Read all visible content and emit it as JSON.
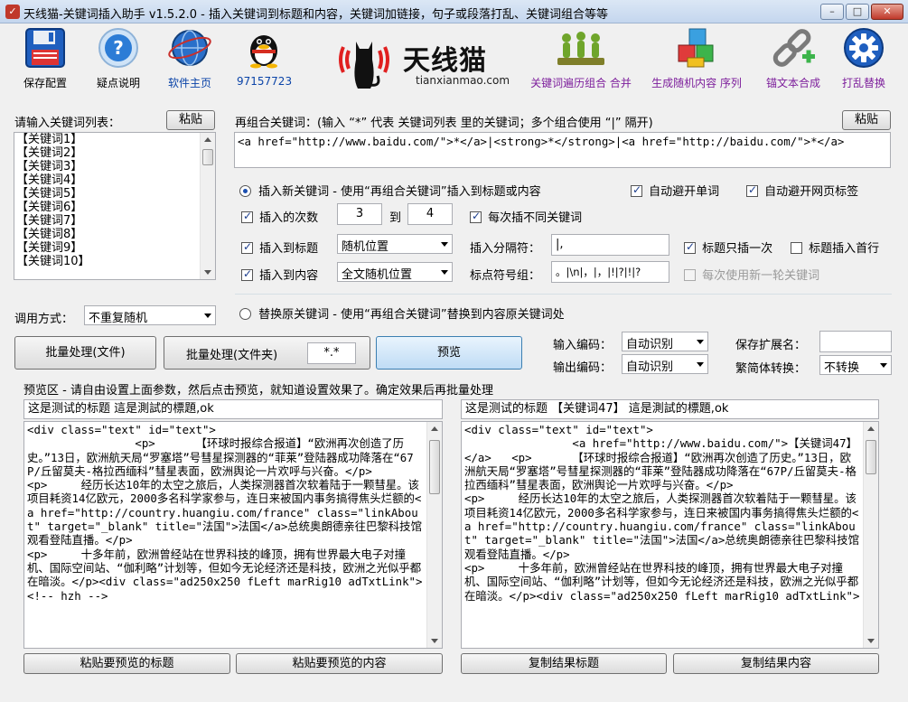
{
  "window": {
    "title": "天线猫-关键词插入助手 v1.5.2.0 - 插入关键词到标题和内容，关键词加链接，句子或段落打乱、关键词组合等等",
    "min_label": "–",
    "max_label": "□",
    "close_label": "✕"
  },
  "toolbar": {
    "save_config": "保存配置",
    "faq": "疑点说明",
    "homepage": "软件主页",
    "qq": "97157723",
    "logo_text": "天线猫",
    "logo_domain": "tianxianmao.com",
    "kw_traverse": "关键词遍历组合 合并",
    "gen_random": "生成随机内容 序列",
    "anchor_merge": "锚文本合成",
    "shuffle_replace": "打乱替换"
  },
  "keywords": {
    "label": "请输入关键词列表：",
    "paste": "粘贴",
    "items": [
      "【关键词1】",
      "【关键词2】",
      "【关键词3】",
      "【关键词4】",
      "【关键词5】",
      "【关键词6】",
      "【关键词7】",
      "【关键词8】",
      "【关键词9】",
      "【关键词10】"
    ]
  },
  "recombine": {
    "label": "再组合关键词：(输入 “*” 代表 关键词列表 里的关键词；多个组合使用 “|” 隔开)",
    "paste": "粘贴",
    "value": "<a href=\"http://www.baidu.com/\">*</a>|<strong>*</strong>|<a href=\"http://baidu.com/\">*</a>"
  },
  "options": {
    "insert_new": "插入新关键词 - 使用“再组合关键词”插入到标题或内容",
    "auto_avoid_word": "自动避开单词",
    "auto_avoid_tag": "自动避开网页标签",
    "insert_times": "插入的次数",
    "times_from": "3",
    "to": "到",
    "times_to": "4",
    "diff_each": "每次插不同关键词",
    "insert_title": "插入到标题",
    "title_pos": "随机位置",
    "separator_label": "插入分隔符：",
    "separator_value": "|,",
    "title_once": "标题只插一次",
    "title_first": "标题插入首行",
    "insert_content": "插入到内容",
    "content_pos": "全文随机位置",
    "punct_label": "标点符号组：",
    "punct_value": "。|\\n|，|，|!|?|!|?",
    "new_round": "每次使用新一轮关键词",
    "replace_orig": "替换原关键词 - 使用“再组合关键词”替换到内容原关键词处",
    "call_mode_label": "调用方式：",
    "call_mode": "不重复随机"
  },
  "actions": {
    "batch_file": "批量处理(文件)",
    "batch_folder": "批量处理(文件夹)",
    "ext_filter": "*.*",
    "preview": "预览",
    "input_enc_label": "输入编码：",
    "input_enc": "自动识别",
    "output_enc_label": "输出编码：",
    "output_enc": "自动识别",
    "save_ext_label": "保存扩展名：",
    "save_ext": "",
    "trad_label": "繁简体转换：",
    "trad_value": "不转换"
  },
  "preview": {
    "hint": "预览区 - 请自由设置上面参数，然后点击预览，就知道设置效果了。确定效果后再批量处理",
    "left_title": "这是测试的标题 這是測試的標題,ok",
    "right_title": "这是测试的标题 【关键词47】 這是測試的標題,ok",
    "left_content": "<div class=\"text\" id=\"text\">\n                <p>      【环球时报综合报道】“欧洲再次创造了历史。”13日，欧洲航天局“罗塞塔”号彗星探测器的“菲莱”登陆器成功降落在“67P/丘留莫夫-格拉西缅科”彗星表面，欧洲舆论一片欢呼与兴奋。</p>\n<p>     经历长达10年的太空之旅后，人类探测器首次软着陆于一颗彗星。该项目耗资14亿欧元，2000多名科学家参与，连日来被国内事务搞得焦头烂额的<a href=\"http://country.huangiu.com/france\" class=\"linkAbout\" target=\"_blank\" title=\"法国\">法国</a>总统奥朗德亲往巴黎科技馆观看登陆直播。</p>\n<p>     十多年前，欧洲曾经站在世界科技的峰顶，拥有世界最大电子对撞机、国际空间站、“伽利略”计划等，但如今无论经济还是科技，欧洲之光似乎都在暗淡。</p><div class=\"ad250x250 fLeft marRig10 adTxtLink\">\n<!-- hzh -->",
    "right_content": "<div class=\"text\" id=\"text\">\n                <a href=\"http://www.baidu.com/\">【关键词47】</a>   <p>      【环球时报综合报道】“欧洲再次创造了历史。”13日，欧洲航天局“罗塞塔”号彗星探测器的“菲莱”登陆器成功降落在“67P/丘留莫夫-格拉西缅科”彗星表面，欧洲舆论一片欢呼与兴奋。</p>\n<p>     经历长达10年的太空之旅后，人类探测器首次软着陆于一颗彗星。该项目耗资14亿欧元，2000多名科学家参与，连日来被国内事务搞得焦头烂额的<a href=\"http://country.huangiu.com/france\" class=\"linkAbout\" target=\"_blank\" title=\"法国\">法国</a>总统奥朗德亲往巴黎科技馆观看登陆直播。</p>\n<p>     十多年前，欧洲曾经站在世界科技的峰顶，拥有世界最大电子对撞机、国际空间站、“伽利略”计划等，但如今无论经济还是科技，欧洲之光似乎都在暗淡。</p><div class=\"ad250x250 fLeft marRig10 adTxtLink\">",
    "paste_title": "粘贴要预览的标题",
    "paste_content": "粘贴要预览的内容",
    "copy_title": "复制结果标题",
    "copy_content": "复制结果内容"
  }
}
